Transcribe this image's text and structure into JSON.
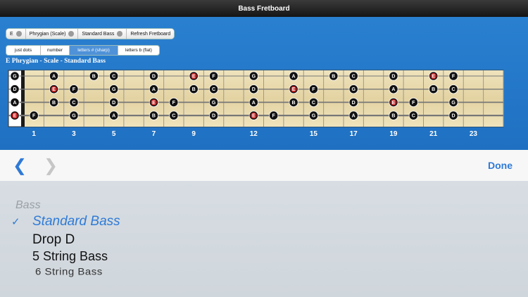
{
  "app": {
    "title": "Bass Fretboard"
  },
  "toolbar": {
    "key": "E",
    "scale": "Phrygian (Scale)",
    "tuning": "Standard Bass",
    "refresh": "Refresh Fretboard"
  },
  "display_modes": [
    {
      "label": "just dots",
      "active": false
    },
    {
      "label": "number",
      "active": false
    },
    {
      "label": "letters # (sharp)",
      "active": true
    },
    {
      "label": "letters b (flat)",
      "active": false
    }
  ],
  "heading": "E Phrygian - Scale - Standard Bass",
  "fret_numbers": [
    "1",
    "3",
    "5",
    "7",
    "9",
    "12",
    "15",
    "17",
    "19",
    "21",
    "23"
  ],
  "fretboard": {
    "frets": 24,
    "strings": [
      {
        "open": "G",
        "notes": [
          {
            "fret": 2,
            "note": "A",
            "root": false
          },
          {
            "fret": 4,
            "note": "B",
            "root": false
          },
          {
            "fret": 5,
            "note": "C",
            "root": false
          },
          {
            "fret": 7,
            "note": "D",
            "root": false
          },
          {
            "fret": 9,
            "note": "E",
            "root": true
          },
          {
            "fret": 10,
            "note": "F",
            "root": false
          },
          {
            "fret": 12,
            "note": "G",
            "root": false
          },
          {
            "fret": 14,
            "note": "A",
            "root": false
          },
          {
            "fret": 16,
            "note": "B",
            "root": false
          },
          {
            "fret": 17,
            "note": "C",
            "root": false
          },
          {
            "fret": 19,
            "note": "D",
            "root": false
          },
          {
            "fret": 21,
            "note": "E",
            "root": true
          },
          {
            "fret": 22,
            "note": "F",
            "root": false
          }
        ]
      },
      {
        "open": "D",
        "notes": [
          {
            "fret": 2,
            "note": "E",
            "root": true
          },
          {
            "fret": 3,
            "note": "F",
            "root": false
          },
          {
            "fret": 5,
            "note": "G",
            "root": false
          },
          {
            "fret": 7,
            "note": "A",
            "root": false
          },
          {
            "fret": 9,
            "note": "B",
            "root": false
          },
          {
            "fret": 10,
            "note": "C",
            "root": false
          },
          {
            "fret": 12,
            "note": "D",
            "root": false
          },
          {
            "fret": 14,
            "note": "E",
            "root": true
          },
          {
            "fret": 15,
            "note": "F",
            "root": false
          },
          {
            "fret": 17,
            "note": "G",
            "root": false
          },
          {
            "fret": 19,
            "note": "A",
            "root": false
          },
          {
            "fret": 21,
            "note": "B",
            "root": false
          },
          {
            "fret": 22,
            "note": "C",
            "root": false
          }
        ]
      },
      {
        "open": "A",
        "notes": [
          {
            "fret": 2,
            "note": "B",
            "root": false
          },
          {
            "fret": 3,
            "note": "C",
            "root": false
          },
          {
            "fret": 5,
            "note": "D",
            "root": false
          },
          {
            "fret": 7,
            "note": "E",
            "root": true
          },
          {
            "fret": 8,
            "note": "F",
            "root": false
          },
          {
            "fret": 10,
            "note": "G",
            "root": false
          },
          {
            "fret": 12,
            "note": "A",
            "root": false
          },
          {
            "fret": 14,
            "note": "B",
            "root": false
          },
          {
            "fret": 15,
            "note": "C",
            "root": false
          },
          {
            "fret": 17,
            "note": "D",
            "root": false
          },
          {
            "fret": 19,
            "note": "E",
            "root": true
          },
          {
            "fret": 20,
            "note": "F",
            "root": false
          },
          {
            "fret": 22,
            "note": "G",
            "root": false
          }
        ]
      },
      {
        "open": "E",
        "open_root": true,
        "notes": [
          {
            "fret": 1,
            "note": "F",
            "root": false
          },
          {
            "fret": 3,
            "note": "G",
            "root": false
          },
          {
            "fret": 5,
            "note": "A",
            "root": false
          },
          {
            "fret": 7,
            "note": "B",
            "root": false
          },
          {
            "fret": 8,
            "note": "C",
            "root": false
          },
          {
            "fret": 10,
            "note": "D",
            "root": false
          },
          {
            "fret": 12,
            "note": "E",
            "root": true
          },
          {
            "fret": 13,
            "note": "F",
            "root": false
          },
          {
            "fret": 15,
            "note": "G",
            "root": false
          },
          {
            "fret": 17,
            "note": "A",
            "root": false
          },
          {
            "fret": 19,
            "note": "B",
            "root": false
          },
          {
            "fret": 20,
            "note": "C",
            "root": false
          },
          {
            "fret": 22,
            "note": "D",
            "root": false
          }
        ]
      }
    ]
  },
  "nav": {
    "back_icon": "chevron-left-icon",
    "forward_icon": "chevron-right-icon",
    "done": "Done"
  },
  "picker": {
    "header": "Bass",
    "check_icon": "checkmark-icon",
    "selected": "Standard Bass",
    "options": [
      "Drop D",
      "5 String Bass",
      "6 String Bass"
    ]
  },
  "colors": {
    "blue": "#1f70c2",
    "accent": "#2f7ad6",
    "root": "#c81e1e",
    "dot": "#111111",
    "wood": "#eadcb0"
  }
}
